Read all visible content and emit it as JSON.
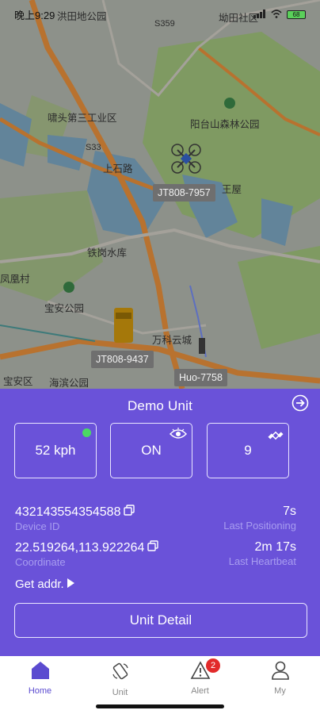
{
  "status_bar": {
    "time": "晚上9:29",
    "battery": "68"
  },
  "map": {
    "labels": [
      "洪田地公园",
      "S359",
      "坳田社区",
      "啸头第三工业区",
      "阳台山森林公园",
      "S33",
      "上石路",
      "铁岗水库",
      "凤凰村",
      "宝安公园",
      "万科云城",
      "王屋",
      "宝安区",
      "海滨公园"
    ],
    "devices": [
      {
        "name": "JT808-7957"
      },
      {
        "name": "JT808-9437"
      },
      {
        "name": "Huo-7758"
      }
    ]
  },
  "unit": {
    "title": "Demo Unit",
    "speed": "52 kph",
    "acc": "ON",
    "satellites": "9",
    "device_id": "432143554354588",
    "device_id_label": "Device ID",
    "last_positioning": "7s",
    "last_positioning_label": "Last Positioning",
    "coordinate": "22.519264,113.922264",
    "coordinate_label": "Coordinate",
    "last_heartbeat": "2m 17s",
    "last_heartbeat_label": "Last Heartbeat",
    "get_addr": "Get addr.",
    "detail_button": "Unit Detail"
  },
  "tabs": [
    {
      "label": "Home",
      "icon": "home-icon",
      "active": true
    },
    {
      "label": "Unit",
      "icon": "unit-icon"
    },
    {
      "label": "Alert",
      "icon": "alert-icon",
      "badge": "2"
    },
    {
      "label": "My",
      "icon": "user-icon"
    }
  ],
  "colors": {
    "accent": "#6a52d9",
    "online": "#4bd964",
    "badge": "#e22a2a"
  }
}
